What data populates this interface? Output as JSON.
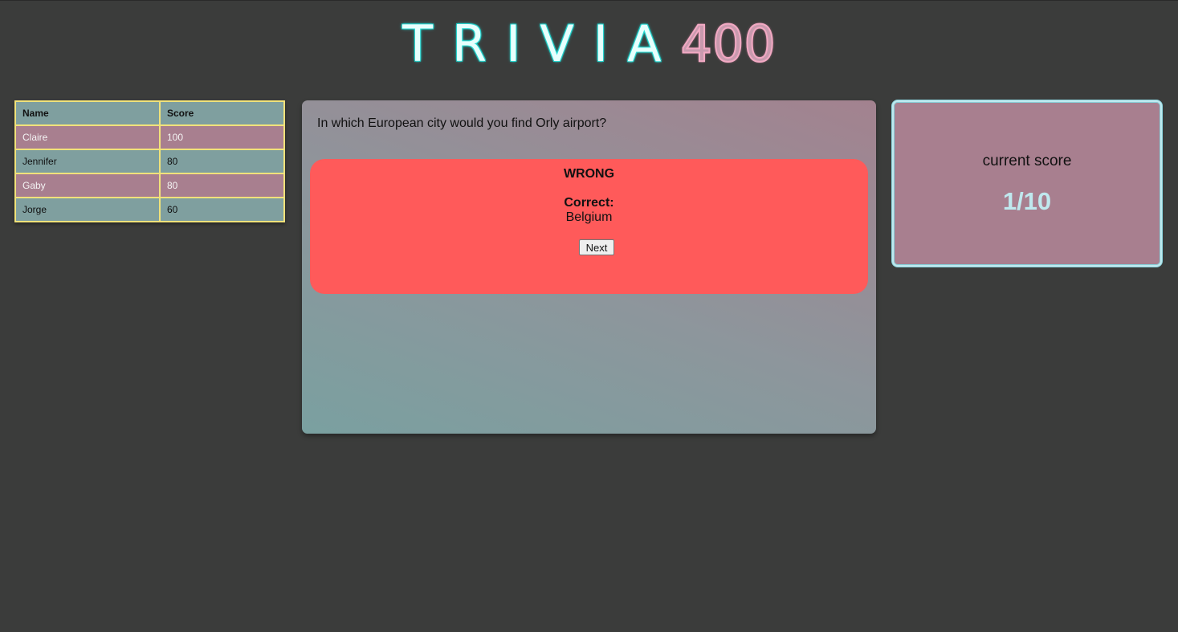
{
  "header": {
    "title_word": "TRIVIA",
    "title_number": "400"
  },
  "leaderboard": {
    "columns": [
      "Name",
      "Score"
    ],
    "rows": [
      {
        "name": "Claire",
        "score": "100"
      },
      {
        "name": "Jennifer",
        "score": "80"
      },
      {
        "name": "Gaby",
        "score": "80"
      },
      {
        "name": "Jorge",
        "score": "60"
      }
    ]
  },
  "question": {
    "text": "In which European city would you find Orly airport?",
    "result": {
      "status": "WRONG",
      "correct_label": "Correct:",
      "correct_answer": "Belgium",
      "next_label": "Next"
    }
  },
  "score": {
    "label": "current score",
    "value": "1/10"
  },
  "colors": {
    "background": "#3b3c3b",
    "teal_row": "#7f9f9f",
    "pink_row": "#a87f8f",
    "table_border": "#f1e27a",
    "wrong_box": "#ff5a5a",
    "score_value": "#bfe8ee"
  }
}
